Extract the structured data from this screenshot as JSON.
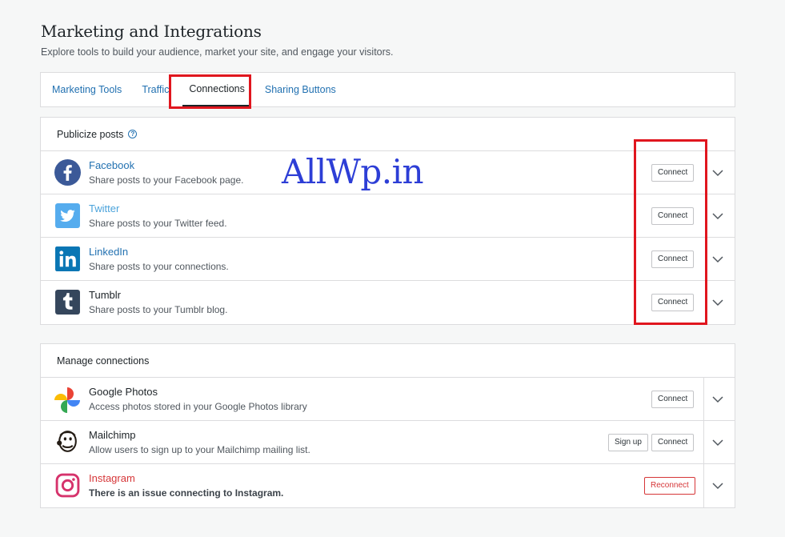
{
  "header": {
    "title": "Marketing and Integrations",
    "subtitle": "Explore tools to build your audience, market your site, and engage your visitors."
  },
  "tabs": [
    {
      "label": "Marketing Tools"
    },
    {
      "label": "Traffic"
    },
    {
      "label": "Connections"
    },
    {
      "label": "Sharing Buttons"
    }
  ],
  "publicize": {
    "header": "Publicize posts",
    "help_icon": "?",
    "items": [
      {
        "name": "Facebook",
        "desc": "Share posts to your Facebook page.",
        "button": "Connect",
        "icon": "facebook-icon"
      },
      {
        "name": "Twitter",
        "desc": "Share posts to your Twitter feed.",
        "button": "Connect",
        "icon": "twitter-icon"
      },
      {
        "name": "LinkedIn",
        "desc": "Share posts to your connections.",
        "button": "Connect",
        "icon": "linkedin-icon"
      },
      {
        "name": "Tumblr",
        "desc": "Share posts to your Tumblr blog.",
        "button": "Connect",
        "icon": "tumblr-icon"
      }
    ]
  },
  "manage": {
    "header": "Manage connections",
    "items": [
      {
        "name": "Google Photos",
        "desc": "Access photos stored in your Google Photos library",
        "button": "Connect",
        "icon": "google-photos-icon"
      },
      {
        "name": "Mailchimp",
        "desc": "Allow users to sign up to your Mailchimp mailing list.",
        "button": "Connect",
        "secondary_button": "Sign up",
        "icon": "mailchimp-icon"
      },
      {
        "name": "Instagram",
        "desc": "There is an issue connecting to Instagram.",
        "button": "Reconnect",
        "icon": "instagram-icon"
      }
    ]
  },
  "watermark": "AllWp.in",
  "colors": {
    "link": "#2271b1",
    "highlight": "#e0161e",
    "facebook": "#3b5998",
    "twitter": "#55acee",
    "linkedin": "#0976b4",
    "tumblr": "#35465c",
    "instagram": "#d6336c",
    "watermark": "#2d3ed6"
  }
}
